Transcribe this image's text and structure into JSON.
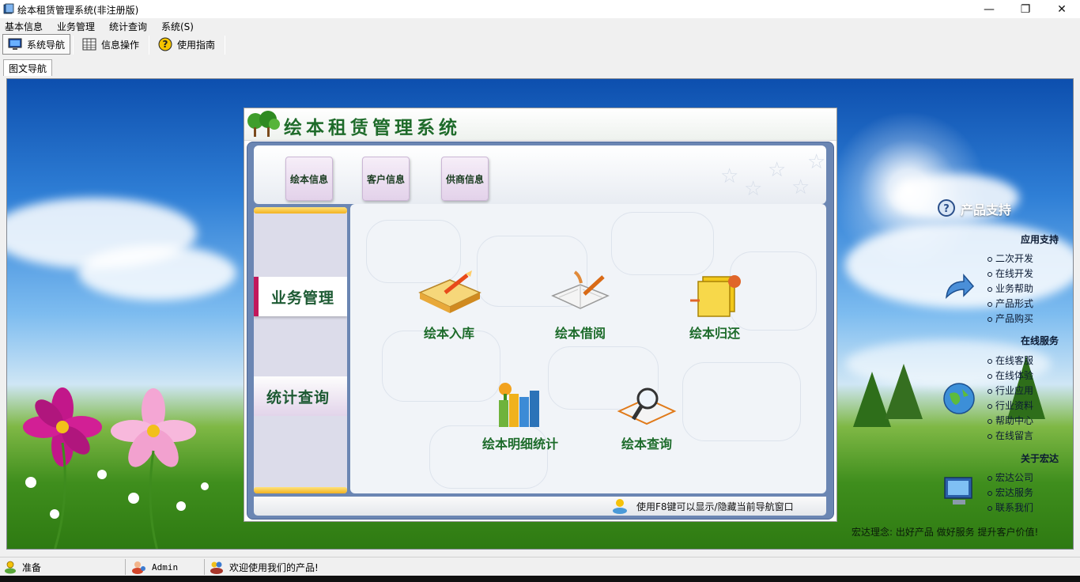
{
  "window": {
    "title": "绘本租赁管理系统(非注册版)",
    "controls": [
      "—",
      "❐",
      "✕"
    ]
  },
  "menu": [
    "基本信息",
    "业务管理",
    "统计查询",
    "系统(S)"
  ],
  "toolbar": {
    "buttons": [
      {
        "label": "系统导航",
        "icon": "monitor-icon",
        "active": true
      },
      {
        "label": "信息操作",
        "icon": "grid-icon",
        "active": false
      },
      {
        "label": "使用指南",
        "icon": "help-icon",
        "active": false
      }
    ]
  },
  "tabs": [
    "图文导航"
  ],
  "nav": {
    "title": "绘本租赁管理系统",
    "top_buttons": [
      "绘本信息",
      "客户信息",
      "供商信息"
    ],
    "left_tabs": {
      "business": "业务管理",
      "stats": "统计查询"
    },
    "features": [
      {
        "label": "绘本入库",
        "icon": "book-pencil-icon"
      },
      {
        "label": "绘本借阅",
        "icon": "open-book-brush-icon"
      },
      {
        "label": "绘本归还",
        "icon": "folder-return-icon"
      },
      {
        "label": "绘本明细统计",
        "icon": "bookshelf-icon"
      },
      {
        "label": "绘本查询",
        "icon": "magnifier-book-icon"
      }
    ],
    "hint": "使用F8键可以显示/隐藏当前导航窗口"
  },
  "support": {
    "title": "产品支持",
    "sections": [
      {
        "heading": "应用支持",
        "links": [
          "二次开发",
          "在线开发",
          "业务帮助",
          "产品形式",
          "产品购买"
        ]
      },
      {
        "heading": "在线服务",
        "links": [
          "在线客服",
          "在线体验",
          "行业应用",
          "行业资料",
          "帮助中心",
          "在线留言"
        ]
      },
      {
        "heading": "关于宏达",
        "links": [
          "宏达公司",
          "宏达服务",
          "联系我们"
        ]
      }
    ],
    "slogan": "宏达理念: 出好产品 做好服务 提升客户价值!"
  },
  "status": {
    "ready": "准备",
    "user": "Admin",
    "welcome": "欢迎使用我们的产品!"
  },
  "colors": {
    "nav_title": "#1e6b2a",
    "accent_tab": "#c2185b",
    "frame": "#6b86b3"
  }
}
